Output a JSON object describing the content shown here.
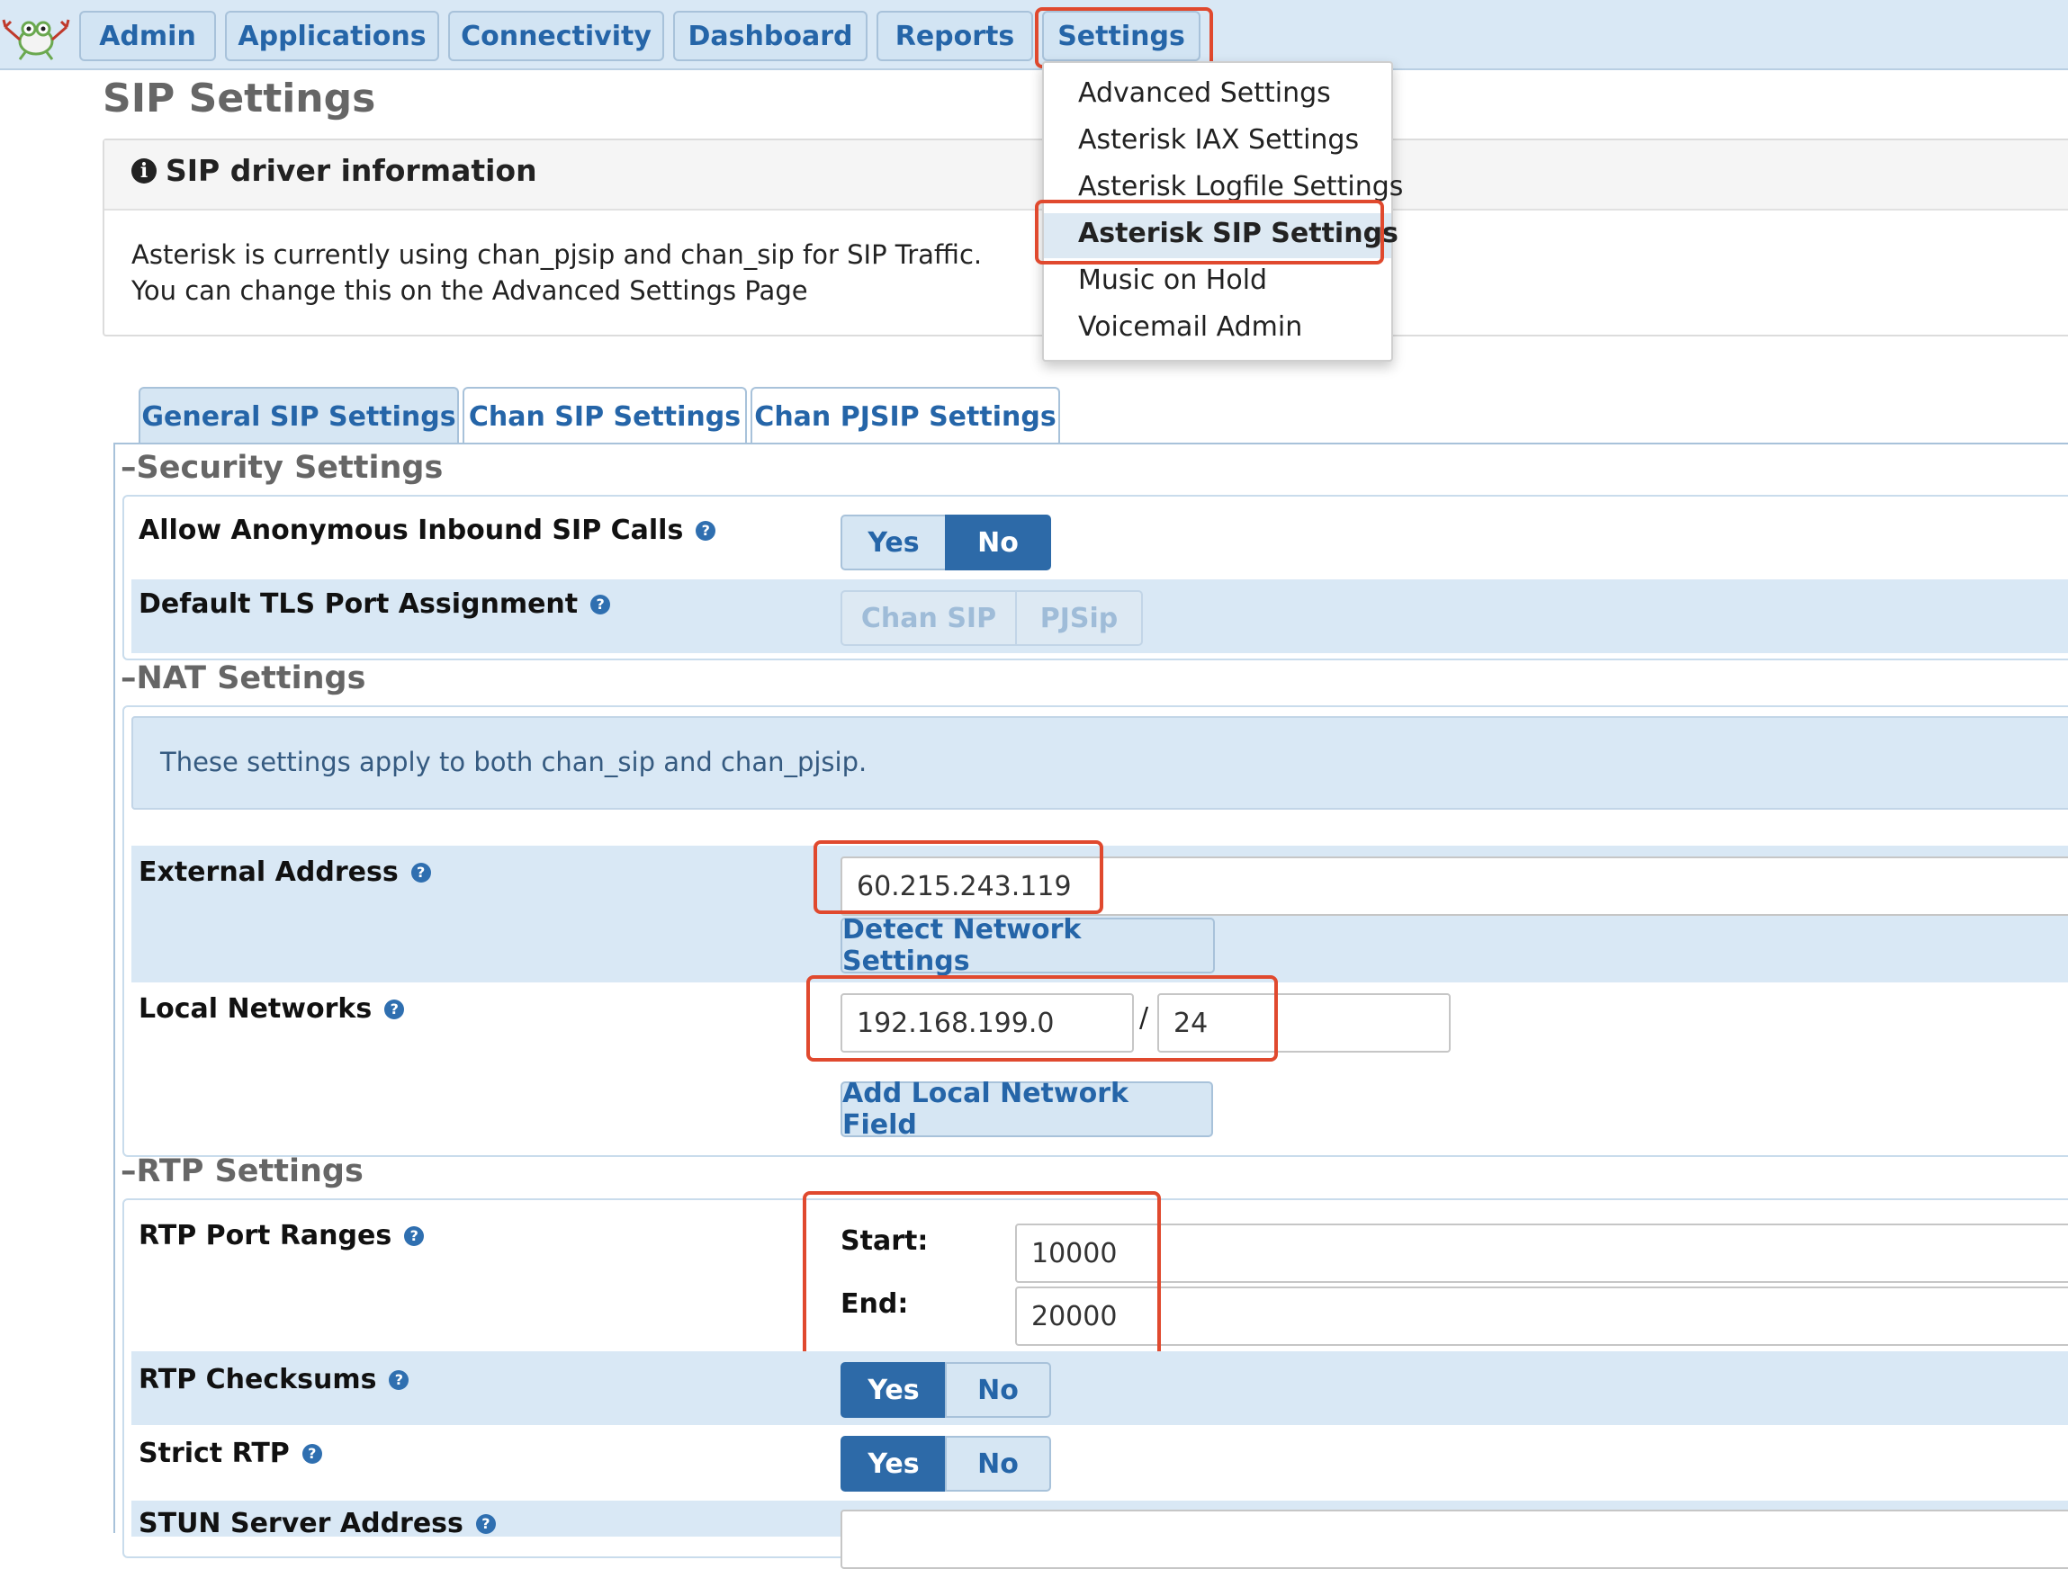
{
  "nav": {
    "items": [
      "Admin",
      "Applications",
      "Connectivity",
      "Dashboard",
      "Reports",
      "Settings"
    ]
  },
  "page": {
    "title": "SIP Settings"
  },
  "info": {
    "icon": "info-circle-icon",
    "title": "SIP driver information",
    "line1": "Asterisk is currently using chan_pjsip and chan_sip for SIP Traffic.",
    "line2": "You can change this on the Advanced Settings Page"
  },
  "settings_menu": {
    "items": [
      "Advanced Settings",
      "Asterisk IAX Settings",
      "Asterisk Logfile Settings",
      "Asterisk SIP Settings",
      "Music on Hold",
      "Voicemail Admin"
    ],
    "selected": "Asterisk SIP Settings"
  },
  "tabs": [
    "General SIP Settings",
    "Chan SIP Settings",
    "Chan PJSIP Settings"
  ],
  "security": {
    "title": "Security Settings",
    "anon_label": "Allow Anonymous Inbound SIP Calls",
    "anon_yes": "Yes",
    "anon_no": "No",
    "tls_label": "Default TLS Port Assignment",
    "tls_chan": "Chan SIP",
    "tls_pjsip": "PJSip"
  },
  "nat": {
    "title": "NAT Settings",
    "note": "These settings apply to both chan_sip and chan_pjsip.",
    "ext_label": "External Address",
    "ext_value": "60.215.243.119",
    "detect_button": "Detect Network Settings",
    "local_label": "Local Networks",
    "local_network": "192.168.199.0",
    "local_slash": "/",
    "local_cidr": "24",
    "add_button": "Add Local Network Field"
  },
  "rtp": {
    "title": "RTP Settings",
    "ranges_label": "RTP Port Ranges",
    "start_label": "Start:",
    "start_value": "10000",
    "end_label": "End:",
    "end_value": "20000",
    "checksums_label": "RTP Checksums",
    "checksums_yes": "Yes",
    "checksums_no": "No",
    "strict_label": "Strict RTP",
    "strict_yes": "Yes",
    "strict_no": "No",
    "stun_label": "STUN Server Address"
  },
  "colors": {
    "accent": "#2565a8",
    "nav_bg": "#d9e8f5",
    "active_toggle": "#2d6aa8",
    "annotation": "#e0492e"
  }
}
